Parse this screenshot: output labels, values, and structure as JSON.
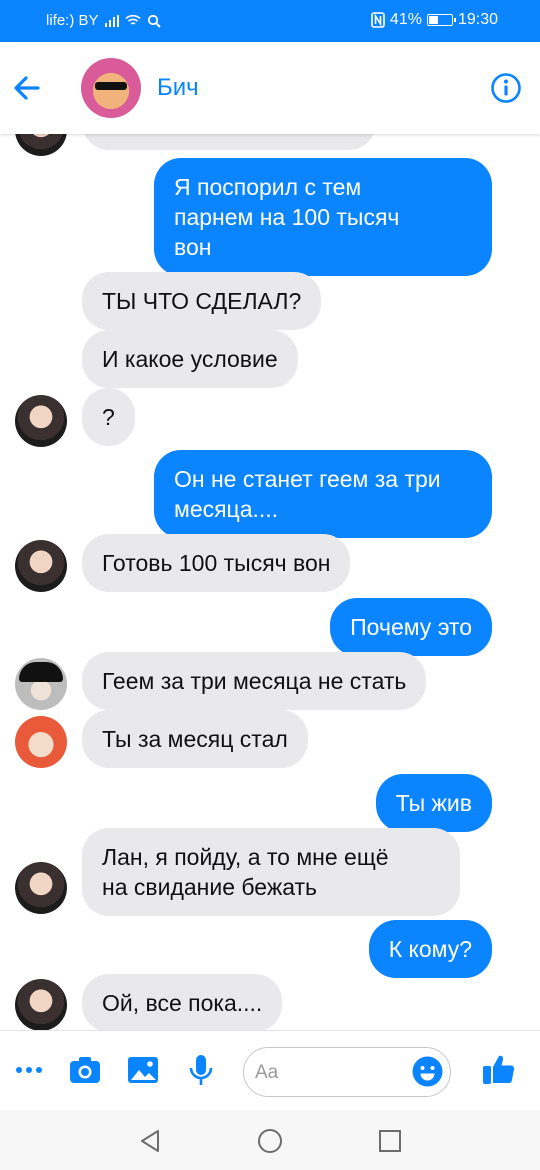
{
  "status_bar": {
    "carrier": "life:) BY",
    "battery": "41%",
    "time": "19:30",
    "icons": [
      "signal-icon",
      "wifi-icon",
      "search-icon",
      "nfc-icon",
      "battery-icon"
    ]
  },
  "header": {
    "contact_name": "Бич",
    "icons": [
      "back-arrow-icon",
      "info-icon"
    ]
  },
  "messages": [
    {
      "side": "out",
      "text": "Я поспорил с тем\nпарнем на 100 тысяч\nвон"
    },
    {
      "side": "in",
      "text": "ТЫ ЧТО СДЕЛАЛ?"
    },
    {
      "side": "in",
      "text": "И какое условие"
    },
    {
      "side": "in",
      "text": "?",
      "avatar": "dark-hair"
    },
    {
      "side": "out",
      "text": "Он не станет геем за три\nмесяца...."
    },
    {
      "side": "in",
      "text": "Готовь 100 тысяч вон",
      "avatar": "dark-hair"
    },
    {
      "side": "out",
      "text": "Почему это"
    },
    {
      "side": "in",
      "text": "Геем за три месяца не стать",
      "avatar": "black-hat"
    },
    {
      "side": "in",
      "text": "Ты за месяц стал",
      "avatar": "red-hair"
    },
    {
      "side": "out",
      "text": "Ты жив"
    },
    {
      "side": "in",
      "text": "Лан, я пойду, а то мне ещё\nна свидание бежать",
      "avatar": "dark-hair"
    },
    {
      "side": "out",
      "text": "К кому?"
    },
    {
      "side": "in",
      "text": "Ой, все пока....",
      "avatar": "dark-hair"
    }
  ],
  "composer": {
    "placeholder": "Aa",
    "icons": [
      "more-icon",
      "camera-icon",
      "image-icon",
      "microphone-icon",
      "emoji-icon",
      "like-icon"
    ]
  },
  "navbar": {
    "icons": [
      "nav-back-icon",
      "nav-home-icon",
      "nav-recents-icon"
    ]
  },
  "colors": {
    "accent": "#0a84ff",
    "incoming_bubble": "#e9e9eb",
    "outgoing_text": "#ffffff"
  }
}
